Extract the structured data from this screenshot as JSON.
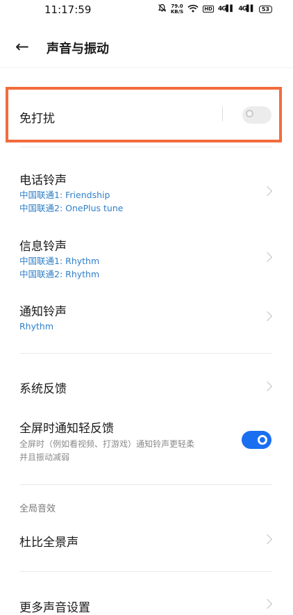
{
  "status_bar": {
    "time": "11:17:59",
    "net_speed_value": "79.0",
    "net_speed_unit": "KB/S",
    "hd": "HD",
    "signal1": "4G",
    "signal2": "4G",
    "battery": "53"
  },
  "header": {
    "back_icon": "←",
    "title": "声音与振动"
  },
  "dnd": {
    "label": "免打扰",
    "enabled": false
  },
  "ringtone": {
    "label": "电话铃声",
    "sim1": "中国联通1: Friendship",
    "sim2": "中国联通2: OnePlus tune"
  },
  "message_tone": {
    "label": "信息铃声",
    "sim1": "中国联通1: Rhythm",
    "sim2": "中国联通2: Rhythm"
  },
  "notification_tone": {
    "label": "通知铃声",
    "value": "Rhythm"
  },
  "system_feedback": {
    "label": "系统反馈"
  },
  "fullscreen_feedback": {
    "label": "全屏时通知轻反馈",
    "desc_line1": "全屏时（例如看视频、打游戏）通知铃声更轻柔",
    "desc_line2": "并且振动减弱",
    "enabled": true
  },
  "global_audio": {
    "section_title": "全局音效",
    "dolby_label": "杜比全景声"
  },
  "more_sound": {
    "label": "更多声音设置"
  },
  "colors": {
    "accent": "#1a6ff1",
    "link_blue": "#2f7fc8",
    "highlight": "#f36b3c"
  }
}
